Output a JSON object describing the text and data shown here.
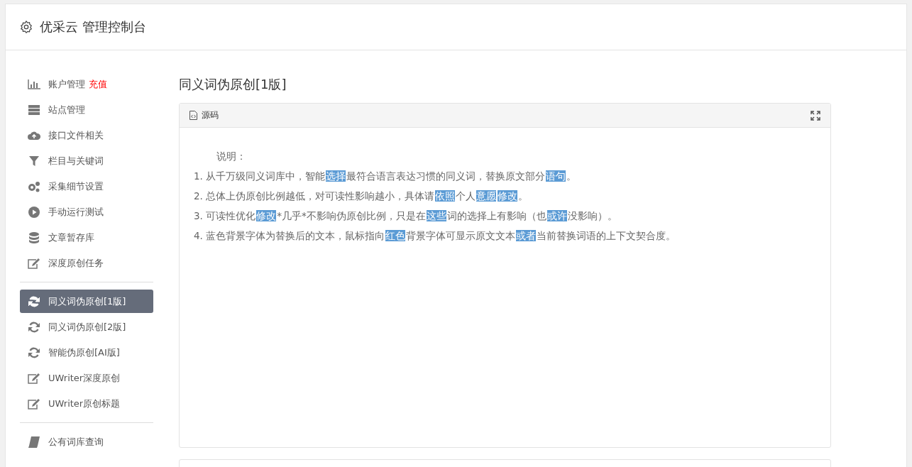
{
  "header": {
    "title": "优采云 管理控制台"
  },
  "sidebar": {
    "groups": [
      {
        "items": [
          {
            "label": "账户管理",
            "badge": "充值",
            "selected": false
          },
          {
            "label": "站点管理",
            "selected": false
          },
          {
            "label": "接口文件相关",
            "selected": false
          },
          {
            "label": "栏目与关键词",
            "selected": false
          },
          {
            "label": "采集细节设置",
            "selected": false
          },
          {
            "label": "手动运行测试",
            "selected": false
          },
          {
            "label": "文章暂存库",
            "selected": false
          },
          {
            "label": "深度原创任务",
            "selected": false
          }
        ]
      },
      {
        "items": [
          {
            "label": "同义词伪原创[1版]",
            "selected": true
          },
          {
            "label": "同义词伪原创[2版]",
            "selected": false
          },
          {
            "label": "智能伪原创[AI版]",
            "selected": false
          },
          {
            "label": "UWriter深度原创",
            "selected": false
          },
          {
            "label": "UWriter原创标题",
            "selected": false
          }
        ]
      },
      {
        "items": [
          {
            "label": "公有词库查询",
            "selected": false
          }
        ]
      }
    ]
  },
  "content": {
    "title": "同义词伪原创[1版]",
    "panel": {
      "title": "源码",
      "heading": "说明：",
      "lines": [
        [
          {
            "text": "1. 从千万级同义词库中，智能",
            "highlighted": false
          },
          {
            "text": "选择",
            "highlighted": true
          },
          {
            "text": "最符合语言表达习惯的同义词，替换原文部分",
            "highlighted": false
          },
          {
            "text": "语句",
            "highlighted": true
          },
          {
            "text": "。",
            "highlighted": false
          }
        ],
        [
          {
            "text": "2. 总体上伪原创比例越低，对可读性影响越小，具体请",
            "highlighted": false
          },
          {
            "text": "依照",
            "highlighted": true
          },
          {
            "text": "个人",
            "highlighted": false
          },
          {
            "text": "意愿",
            "highlighted": true
          },
          {
            "text": "修改",
            "highlighted": true
          },
          {
            "text": "。",
            "highlighted": false
          }
        ],
        [
          {
            "text": "3. 可读性优化",
            "highlighted": false
          },
          {
            "text": "修改",
            "highlighted": true
          },
          {
            "text": "*几乎*不影响伪原创比例，只是在",
            "highlighted": false
          },
          {
            "text": "这些",
            "highlighted": true
          },
          {
            "text": "词的选择上有影响（也",
            "highlighted": false
          },
          {
            "text": "或许",
            "highlighted": true
          },
          {
            "text": "没影响）。",
            "highlighted": false
          }
        ],
        [
          {
            "text": "4. 蓝色背景字体为替换后的文本，鼠标指向",
            "highlighted": false
          },
          {
            "text": "红色",
            "highlighted": true
          },
          {
            "text": "背景字体可显示原文文本",
            "highlighted": false
          },
          {
            "text": "或者",
            "highlighted": true
          },
          {
            "text": "当前替换词语的上下文契合度。",
            "highlighted": false
          }
        ]
      ]
    }
  }
}
